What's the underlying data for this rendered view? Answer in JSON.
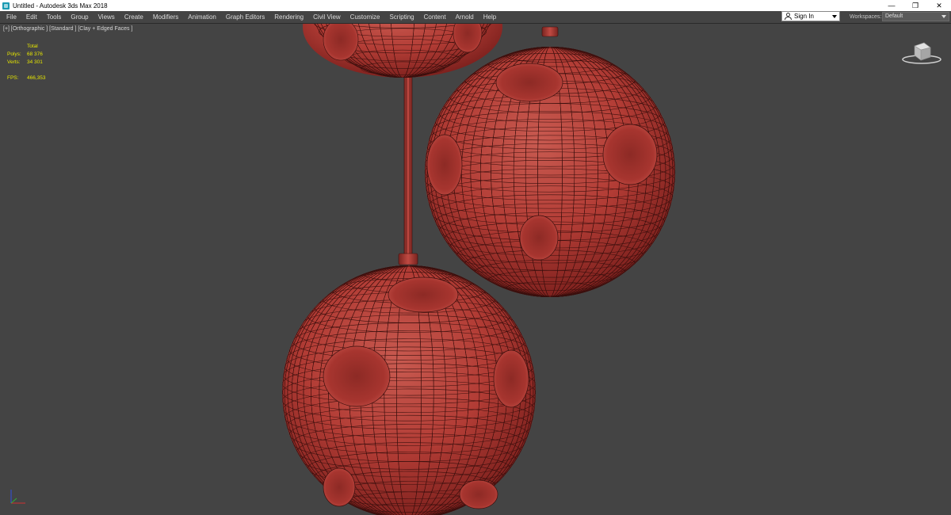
{
  "window": {
    "title": "Untitled - Autodesk 3ds Max 2018",
    "controls": {
      "minimize": "—",
      "restore": "❐",
      "close": "✕"
    }
  },
  "menu": {
    "items": [
      "File",
      "Edit",
      "Tools",
      "Group",
      "Views",
      "Create",
      "Modifiers",
      "Animation",
      "Graph Editors",
      "Rendering",
      "Civil View",
      "Customize",
      "Scripting",
      "Content",
      "Arnold",
      "Help"
    ]
  },
  "account": {
    "signin_label": "Sign In"
  },
  "workspaces": {
    "label": "Workspaces:",
    "value": "Default"
  },
  "viewport": {
    "label": "[+] [Orthographic ] [Standard ] [Clay + Edged Faces ]",
    "stats": {
      "header": "Total",
      "polys_label": "Polys:",
      "polys_value": "68 376",
      "verts_label": "Verts:",
      "verts_value": "34 301",
      "fps_label": "FPS:",
      "fps_value": "466,353"
    }
  },
  "colors": {
    "viewport_bg": "#444444",
    "clay": "#b5403a",
    "wire": "#3a0f0d",
    "stats_text": "#e6e600"
  },
  "icons": {
    "app": "3ds-max-icon",
    "viewcube": "viewcube-icon",
    "axis": "axis-gizmo-icon",
    "user": "user-icon"
  }
}
